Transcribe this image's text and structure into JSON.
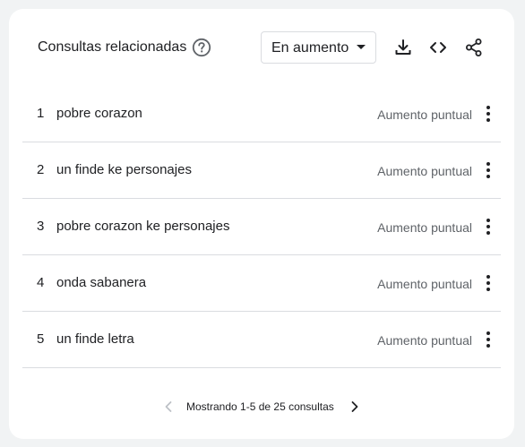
{
  "header": {
    "title": "Consultas relacionadas",
    "help_icon": "help-circle-icon",
    "filter": {
      "selected": "En aumento"
    },
    "tools": [
      "download-icon",
      "embed-code-icon",
      "share-icon"
    ]
  },
  "rows": [
    {
      "rank": "1",
      "query": "pobre corazon",
      "value": "Aumento puntual"
    },
    {
      "rank": "2",
      "query": "un finde ke personajes",
      "value": "Aumento puntual"
    },
    {
      "rank": "3",
      "query": "pobre corazon ke personajes",
      "value": "Aumento puntual"
    },
    {
      "rank": "4",
      "query": "onda sabanera",
      "value": "Aumento puntual"
    },
    {
      "rank": "5",
      "query": "un finde letra",
      "value": "Aumento puntual"
    }
  ],
  "pagination": {
    "text": "Mostrando 1-5 de 25 consultas"
  },
  "colors": {
    "text": "#202124",
    "muted": "#5f6368",
    "divider": "#dadce0",
    "disabled": "#bdc1c6",
    "background": "#f1f3f4",
    "card": "#ffffff"
  }
}
